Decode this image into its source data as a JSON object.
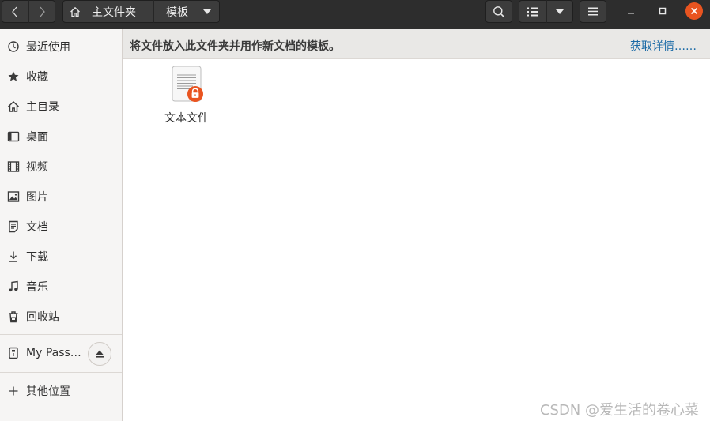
{
  "header": {
    "breadcrumbs": [
      "主文件夹",
      "模板"
    ]
  },
  "sidebar": {
    "items": [
      {
        "label": "最近使用",
        "icon": "clock-icon"
      },
      {
        "label": "收藏",
        "icon": "star-icon"
      },
      {
        "label": "主目录",
        "icon": "home-icon"
      },
      {
        "label": "桌面",
        "icon": "desktop-icon"
      },
      {
        "label": "视频",
        "icon": "film-icon"
      },
      {
        "label": "图片",
        "icon": "image-icon"
      },
      {
        "label": "文档",
        "icon": "document-icon"
      },
      {
        "label": "下载",
        "icon": "download-icon"
      },
      {
        "label": "音乐",
        "icon": "music-icon"
      },
      {
        "label": "回收站",
        "icon": "trash-icon"
      }
    ],
    "device": {
      "label": "My Pass…",
      "icon": "usb-drive-icon"
    },
    "other": {
      "label": "其他位置",
      "icon": "plus-icon"
    }
  },
  "infobar": {
    "message": "将文件放入此文件夹并用作新文档的模板。",
    "link": "获取详情……"
  },
  "files": [
    {
      "name": "文本文件",
      "icon": "text-file-locked-icon"
    }
  ],
  "colors": {
    "accent": "#e95420",
    "headerbar": "#2d2d2d",
    "link": "#1a6aa6"
  },
  "watermark": "CSDN @爱生活的卷心菜"
}
